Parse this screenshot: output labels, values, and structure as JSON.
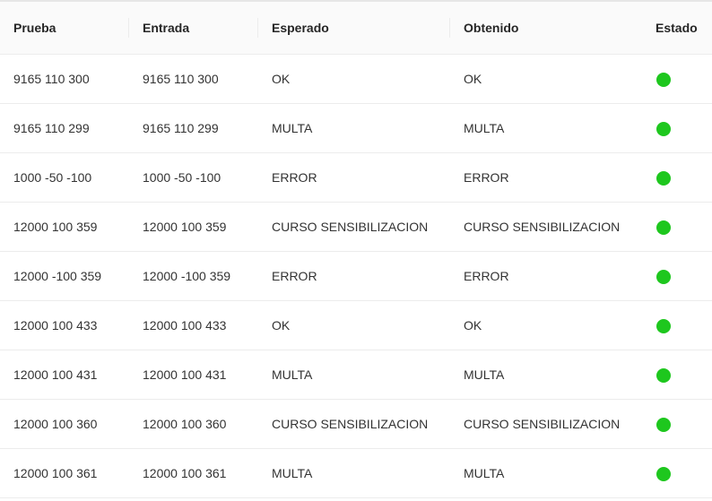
{
  "colors": {
    "status_ok": "#1ec71e"
  },
  "table": {
    "headers": {
      "prueba": "Prueba",
      "entrada": "Entrada",
      "esperado": "Esperado",
      "obtenido": "Obtenido",
      "estado": "Estado"
    },
    "rows": [
      {
        "prueba": "9165 110 300",
        "entrada": "9165 110 300",
        "esperado": "OK",
        "obtenido": "OK",
        "estado": "pass"
      },
      {
        "prueba": "9165 110 299",
        "entrada": "9165 110 299",
        "esperado": "MULTA",
        "obtenido": "MULTA",
        "estado": "pass"
      },
      {
        "prueba": "1000 -50 -100",
        "entrada": "1000 -50 -100",
        "esperado": "ERROR",
        "obtenido": "ERROR",
        "estado": "pass"
      },
      {
        "prueba": "12000 100 359",
        "entrada": "12000 100 359",
        "esperado": "CURSO SENSIBILIZACION",
        "obtenido": "CURSO SENSIBILIZACION",
        "estado": "pass"
      },
      {
        "prueba": "12000 -100 359",
        "entrada": "12000 -100 359",
        "esperado": "ERROR",
        "obtenido": "ERROR",
        "estado": "pass"
      },
      {
        "prueba": "12000 100 433",
        "entrada": "12000 100 433",
        "esperado": "OK",
        "obtenido": "OK",
        "estado": "pass"
      },
      {
        "prueba": "12000 100 431",
        "entrada": "12000 100 431",
        "esperado": "MULTA",
        "obtenido": "MULTA",
        "estado": "pass"
      },
      {
        "prueba": "12000 100 360",
        "entrada": "12000 100 360",
        "esperado": "CURSO SENSIBILIZACION",
        "obtenido": "CURSO SENSIBILIZACION",
        "estado": "pass"
      },
      {
        "prueba": "12000 100 361",
        "entrada": "12000 100 361",
        "esperado": "MULTA",
        "obtenido": "MULTA",
        "estado": "pass"
      }
    ]
  }
}
